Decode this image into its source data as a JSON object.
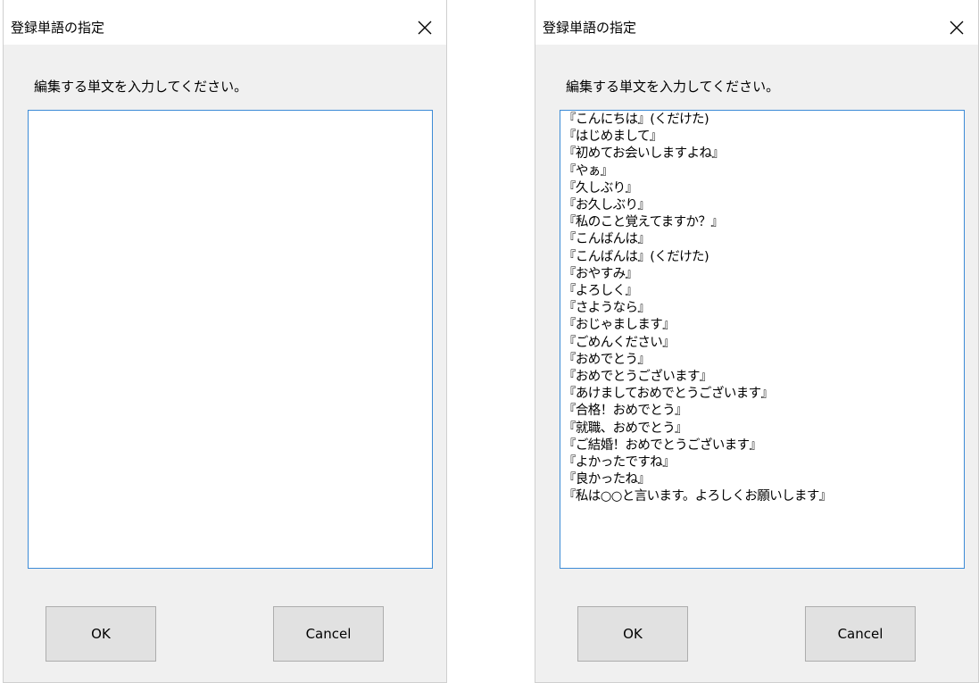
{
  "dialogs": [
    {
      "title": "登録単語の指定",
      "prompt": "編集する単文を入力してください。",
      "lines": [],
      "ok_label": "OK",
      "cancel_label": "Cancel"
    },
    {
      "title": "登録単語の指定",
      "prompt": "編集する単文を入力してください。",
      "lines": [
        "『こんにちは』(くだけた)",
        "『はじめまして』",
        "『初めてお会いしますよね』",
        "『やぁ』",
        "『久しぶり』",
        "『お久しぶり』",
        "『私のこと覚えてますか？』",
        "『こんばんは』",
        "『こんばんは』(くだけた)",
        "『おやすみ』",
        "『よろしく』",
        "『さようなら』",
        "『おじゃまします』",
        "『ごめんください』",
        "『おめでとう』",
        "『おめでとうございます』",
        "『あけましておめでとうございます』",
        "『合格！おめでとう』",
        "『就職、おめでとう』",
        "『ご結婚！おめでとうございます』",
        "『よかったですね』",
        "『良かったね』",
        "『私は○○と言います。よろしくお願いします』"
      ],
      "ok_label": "OK",
      "cancel_label": "Cancel"
    }
  ],
  "icons": {
    "close": "close-icon"
  }
}
